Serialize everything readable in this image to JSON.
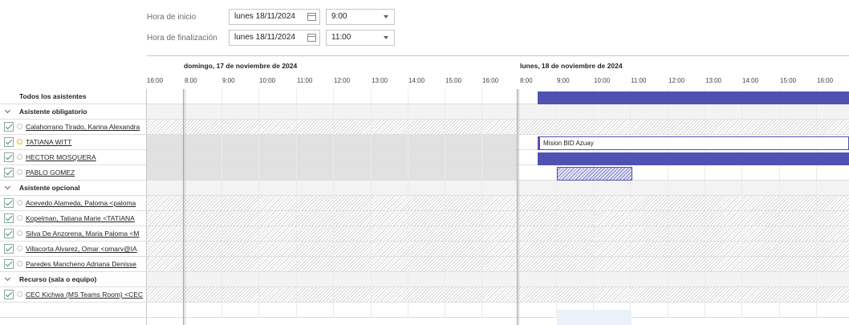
{
  "form": {
    "start_label": "Hora de inicio",
    "start_date": "lunes 18/11/2024",
    "start_time": "9:00",
    "end_label": "Hora de finalización",
    "end_date": "lunes 18/11/2024",
    "end_time": "11:00"
  },
  "timeline": {
    "day1": "domingo, 17 de noviembre de 2024",
    "day2": "lunes, 18 de noviembre de 2024",
    "day1_hours": [
      "16:00",
      "8:00",
      "9:00",
      "10:00",
      "11:00",
      "12:00",
      "13:00",
      "14:00",
      "15:00",
      "16:00"
    ],
    "day2_hours": [
      "8:00",
      "9:00",
      "10:00",
      "11:00",
      "12:00",
      "13:00",
      "14:00",
      "15:00",
      "16:00"
    ]
  },
  "attendees": {
    "all_label": "Todos los asistentes",
    "required_label": "Asistente obligatorio",
    "required": [
      "Calahorrano Tirado, Karina Alexandra",
      "TATIANA WITT",
      "HECTOR MOSQUERA",
      "PABLO GOMEZ"
    ],
    "optional_label": "Asistente opcional",
    "optional": [
      "Acevedo Alameda, Paloma <paloma",
      "Kopelman, Tatiana Marie <TATIANA",
      "Silva De Anzorena, Maria Paloma <M",
      "Villacorta Alvarez, Omar <omarv@IA",
      "Paredes Mancheno Adriana Denisse"
    ],
    "resource_label": "Recurso (sala o equipo)",
    "resources": [
      "CEC Kichwa (MS Teams Room) <CEC"
    ]
  },
  "event": {
    "title": "Mision BID Azuay"
  },
  "colors": {
    "busy": "#4f52b2",
    "tentative": "#f1b80a",
    "hatch": "#d6d6d6"
  }
}
